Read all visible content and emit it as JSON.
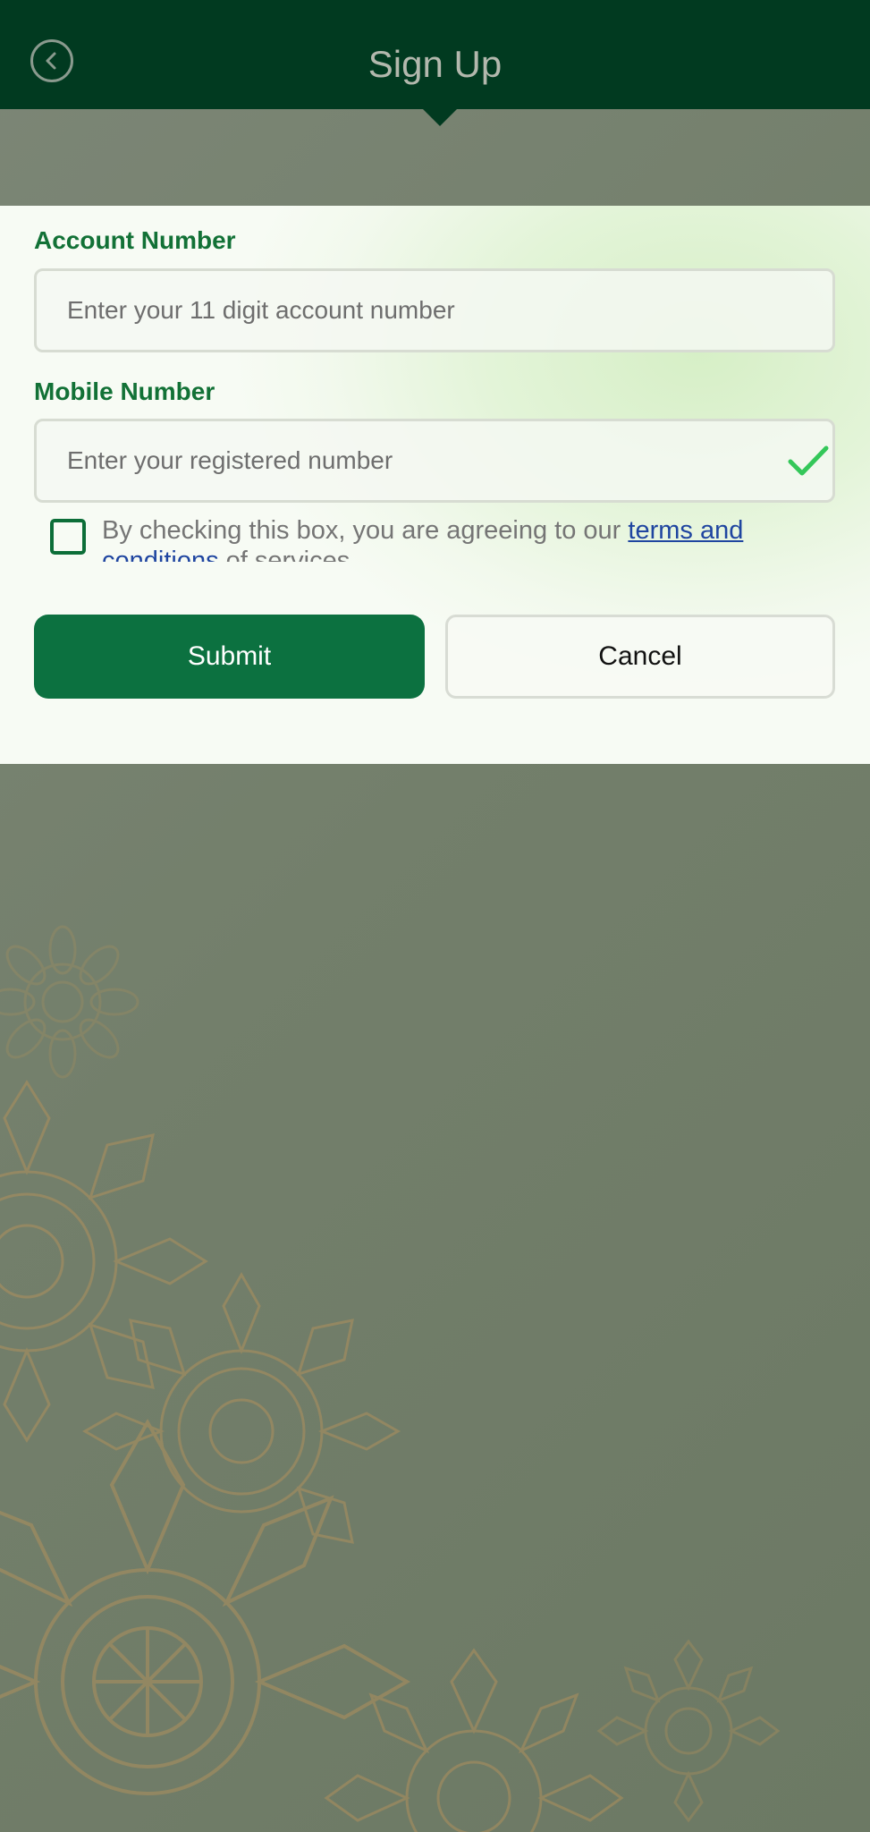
{
  "header": {
    "title": "Sign Up",
    "back_icon": "chevron-left-circle-icon"
  },
  "form": {
    "account": {
      "label": "Account Number",
      "placeholder": "Enter your 11 digit account number",
      "value": ""
    },
    "mobile": {
      "label": "Mobile Number",
      "placeholder": "Enter your registered number",
      "value": "",
      "valid_icon": "checkmark-icon"
    },
    "terms": {
      "checked": false,
      "text_before": "By checking this box, you are agreeing to our ",
      "link": "terms and conditions",
      "text_after": " of services"
    },
    "submit_label": "Submit",
    "cancel_label": "Cancel"
  },
  "colors": {
    "app_bar": "#013a20",
    "primary": "#0c7140",
    "label": "#127136",
    "link": "#1f45a0",
    "check": "#34c759",
    "background": "#737f6b",
    "ornament": "#b0915d"
  }
}
